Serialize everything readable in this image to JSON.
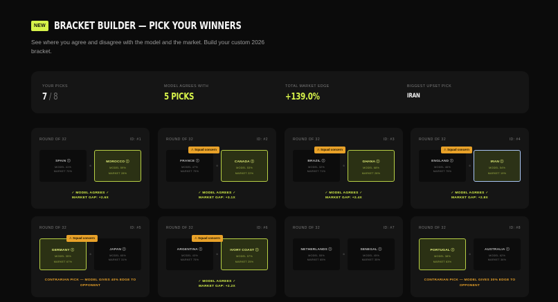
{
  "header": {
    "badge": "NEW",
    "title": "BRACKET BUILDER — PICK YOUR WINNERS",
    "subtitle": "See where you agree and disagree with the model and the market. Build your custom 2026 bracket."
  },
  "stats": {
    "picks_label": "YOUR PICKS",
    "picks_value": "7",
    "picks_sep": " / ",
    "picks_total": "8",
    "agree_label": "MODEL AGREES WITH",
    "agree_value": "5 PICKS",
    "edge_label": "TOTAL MARKET EDGE",
    "edge_value": "+139.0%",
    "upset_label": "BIGGEST UPSET PICK",
    "upset_value": "IRAN"
  },
  "colors": {
    "accent": "#d7f34a",
    "concern": "#e9a229",
    "upset_border": "#aac6f6"
  },
  "icons": {
    "info": "info-icon",
    "vs": "vs-icon"
  },
  "matches": [
    {
      "round": "ROUND OF 32",
      "id": "ID: #1",
      "concern": "",
      "team1": {
        "name": "SPAIN",
        "model": "MODEL 41%",
        "market": "MARKET 70%"
      },
      "team2": {
        "name": "MOROCCO",
        "model": "MODEL 59%",
        "market": "MARKET 28%"
      },
      "verdict": "✓ MODEL AGREES ✓",
      "gap": "MARKET GAP: +2.6X"
    },
    {
      "round": "ROUND OF 32",
      "id": "ID: #2",
      "concern": "Squad concern",
      "team1": {
        "name": "FRANCE",
        "model": "MODEL 47%",
        "market": "MARKET 75%"
      },
      "team2": {
        "name": "CANADA",
        "model": "MODEL 53%",
        "market": "MARKET 22%"
      },
      "verdict": "✓ MODEL AGREES ✓",
      "gap": "MARKET GAP: +3.1X"
    },
    {
      "round": "ROUND OF 32",
      "id": "ID: #3",
      "concern": "Squad concern",
      "team1": {
        "name": "BRAZIL",
        "model": "MODEL 32%",
        "market": "MARKET 71%"
      },
      "team2": {
        "name": "GHANA",
        "model": "MODEL 68%",
        "market": "MARKET 28%"
      },
      "verdict": "✓ MODEL AGREES ✓",
      "gap": "MARKET GAP: +2.4X"
    },
    {
      "round": "ROUND OF 32",
      "id": "ID: #4",
      "concern": "Squad concern",
      "team1": {
        "name": "ENGLAND",
        "model": "MODEL 46%",
        "market": "MARKET 75%"
      },
      "team2": {
        "name": "IRAN",
        "model": "MODEL 54%",
        "market": "MARKET 19%"
      },
      "verdict": "✓ MODEL AGREES ✓",
      "gap": "MARKET GAP: +2.8X"
    },
    {
      "round": "ROUND OF 32",
      "id": "ID: #5",
      "concern": "Squad concern",
      "team1": {
        "name": "GERMANY",
        "model": "MODEL 35%",
        "market": "MARKET 67%"
      },
      "team2": {
        "name": "JAPAN",
        "model": "MODEL 65%",
        "market": "MARKET 31%"
      },
      "verdict": "CONTRARIAN PICK — MODEL GIVES 40% EDGE TO OPPONENT",
      "gap": ""
    },
    {
      "round": "ROUND OF 32",
      "id": "ID: #6",
      "concern": "Squad concern",
      "team1": {
        "name": "ARGENTINA",
        "model": "MODEL 43%",
        "market": "MARKET 75%"
      },
      "team2": {
        "name": "IVORY COAST",
        "model": "MODEL 57%",
        "market": "MARKET 25%"
      },
      "verdict": "✓ MODEL AGREES ✓",
      "gap": "MARKET GAP: +2.2X"
    },
    {
      "round": "ROUND OF 32",
      "id": "ID: #7",
      "concern": "",
      "team1": {
        "name": "NETHERLANDS",
        "model": "MODEL 55%",
        "market": "MARKET 65%"
      },
      "team2": {
        "name": "SENEGAL",
        "model": "MODEL 45%",
        "market": "MARKET 35%"
      },
      "verdict": "",
      "gap": ""
    },
    {
      "round": "ROUND OF 32",
      "id": "ID: #8",
      "concern": "",
      "team1": {
        "name": "PORTUGAL",
        "model": "MODEL 38%",
        "market": "MARKET 63%"
      },
      "team2": {
        "name": "AUSTRALIA",
        "model": "MODEL 62%",
        "market": "MARKET 36%"
      },
      "verdict": "CONTRARIAN PICK — MODEL GIVES 30% EDGE TO OPPONENT",
      "gap": ""
    }
  ]
}
